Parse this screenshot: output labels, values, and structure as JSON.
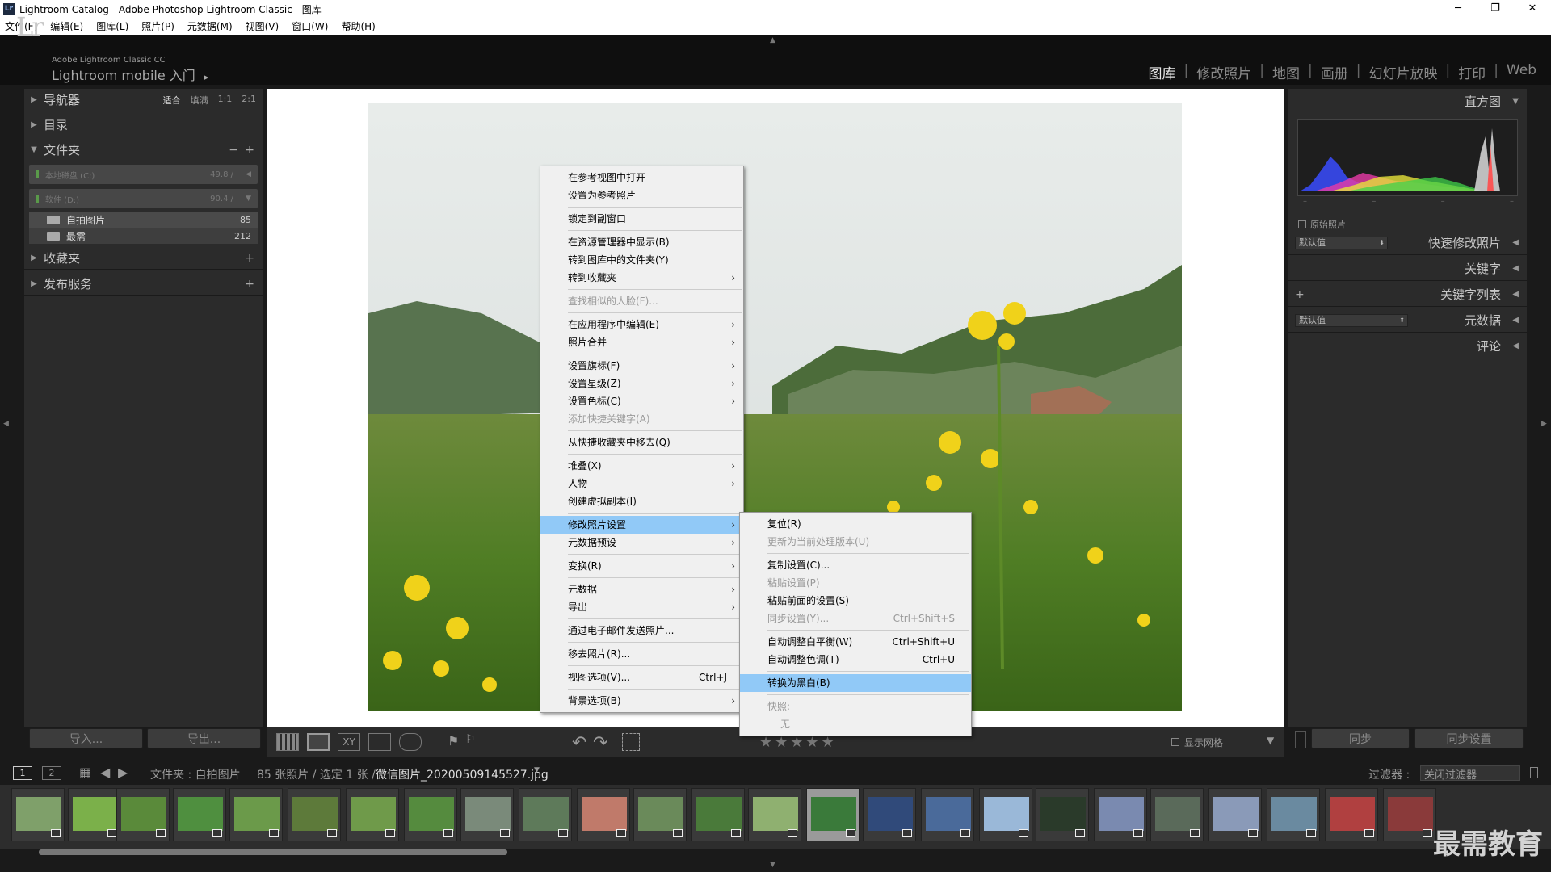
{
  "window": {
    "title": "Lightroom Catalog - Adobe Photoshop Lightroom Classic - 图库",
    "app_icon": "Lr",
    "minimize": "─",
    "maximize": "❐",
    "close": "✕"
  },
  "menubar": [
    "文件(F)",
    "编辑(E)",
    "图库(L)",
    "照片(P)",
    "元数据(M)",
    "视图(V)",
    "窗口(W)",
    "帮助(H)"
  ],
  "identity": {
    "logo": "Lr",
    "small": "Adobe Lightroom Classic CC",
    "mobile": "Lightroom mobile 入门",
    "mobile_arrow": "▸"
  },
  "modules": [
    "图库",
    "修改照片",
    "地图",
    "画册",
    "幻灯片放映",
    "打印",
    "Web"
  ],
  "left_panel": {
    "navigator": {
      "label": "导航器",
      "modes": [
        "适合",
        "填满",
        "1:1",
        "2:1"
      ]
    },
    "catalog": {
      "label": "目录"
    },
    "folders": {
      "label": "文件夹",
      "minus": "−",
      "plus": "+",
      "volumes": [
        {
          "name": "本地磁盘 (C:)",
          "size": "49.8 /",
          "arrow": "◀"
        },
        {
          "name": "软件 (D:)",
          "size": "90.4 /",
          "arrow": "▼"
        }
      ],
      "items": [
        {
          "name": "自拍图片",
          "count": "85"
        },
        {
          "name": "最需",
          "count": "212"
        }
      ]
    },
    "collections": {
      "label": "收藏夹",
      "plus": "+"
    },
    "publish": {
      "label": "发布服务",
      "plus": "+"
    },
    "import_label": "导入...",
    "export_label": "导出..."
  },
  "right_panel": {
    "histogram": {
      "label": "直方图",
      "original_photo": "原始照片",
      "dashes": "–"
    },
    "quick_develop": {
      "label": "快速修改照片",
      "preset": "默认值"
    },
    "keywording": {
      "label": "关键字"
    },
    "keyword_list": {
      "label": "关键字列表",
      "plus": "+"
    },
    "metadata": {
      "label": "元数据",
      "preset": "默认值"
    },
    "comments": {
      "label": "评论"
    },
    "sync_label": "同步",
    "sync_settings_label": "同步设置"
  },
  "toolbar": {
    "stars": "★★★★★",
    "show_grid": "显示网格",
    "xy": "XY",
    "rotate_left": "↶",
    "rotate_right": "↷"
  },
  "filmstrip_bar": {
    "page1": "1",
    "page2": "2",
    "source_prefix": "文件夹 : 自拍图片",
    "count_info": "85 张照片 / 选定 1 张 /",
    "filename": "微信图片_20200509145527.jpg",
    "filter_label": "过滤器 :",
    "filter_value": "关闭过滤器"
  },
  "context_menu": {
    "items": [
      {
        "label": "在参考视图中打开"
      },
      {
        "label": "设置为参考照片"
      },
      {
        "sep": true
      },
      {
        "label": "锁定到副窗口"
      },
      {
        "sep": true
      },
      {
        "label": "在资源管理器中显示(B)"
      },
      {
        "label": "转到图库中的文件夹(Y)"
      },
      {
        "label": "转到收藏夹",
        "sub": true
      },
      {
        "sep": true
      },
      {
        "label": "查找相似的人脸(F)...",
        "disabled": true
      },
      {
        "sep": true
      },
      {
        "label": "在应用程序中编辑(E)",
        "sub": true
      },
      {
        "label": "照片合并",
        "sub": true
      },
      {
        "sep": true
      },
      {
        "label": "设置旗标(F)",
        "sub": true
      },
      {
        "label": "设置星级(Z)",
        "sub": true
      },
      {
        "label": "设置色标(C)",
        "sub": true
      },
      {
        "label": "添加快捷关键字(A)",
        "disabled": true
      },
      {
        "sep": true
      },
      {
        "label": "从快捷收藏夹中移去(Q)"
      },
      {
        "sep": true
      },
      {
        "label": "堆叠(X)",
        "sub": true
      },
      {
        "label": "人物",
        "sub": true
      },
      {
        "label": "创建虚拟副本(I)"
      },
      {
        "sep": true
      },
      {
        "label": "修改照片设置",
        "sub": true,
        "highlight": true
      },
      {
        "label": "元数据预设",
        "sub": true
      },
      {
        "sep": true
      },
      {
        "label": "变换(R)",
        "sub": true
      },
      {
        "sep": true
      },
      {
        "label": "元数据",
        "sub": true
      },
      {
        "label": "导出",
        "sub": true
      },
      {
        "sep": true
      },
      {
        "label": "通过电子邮件发送照片..."
      },
      {
        "sep": true
      },
      {
        "label": "移去照片(R)..."
      },
      {
        "sep": true
      },
      {
        "label": "视图选项(V)...",
        "shortcut": "Ctrl+J"
      },
      {
        "sep": true
      },
      {
        "label": "背景选项(B)",
        "sub": true
      }
    ],
    "arrow": "›"
  },
  "submenu": {
    "items": [
      {
        "label": "复位(R)"
      },
      {
        "label": "更新为当前处理版本(U)",
        "disabled": true
      },
      {
        "sep": true
      },
      {
        "label": "复制设置(C)..."
      },
      {
        "label": "粘贴设置(P)",
        "disabled": true
      },
      {
        "label": "粘贴前面的设置(S)"
      },
      {
        "label": "同步设置(Y)...",
        "disabled": true,
        "shortcut": "Ctrl+Shift+S"
      },
      {
        "sep": true
      },
      {
        "label": "自动调整白平衡(W)",
        "shortcut": "Ctrl+Shift+U"
      },
      {
        "label": "自动调整色调(T)",
        "shortcut": "Ctrl+U"
      },
      {
        "sep": true
      },
      {
        "label": "转换为黑白(B)",
        "highlight": true
      },
      {
        "sep": true
      },
      {
        "label": "快照:",
        "disabled": true
      },
      {
        "label": "无",
        "disabled": true,
        "indent": true
      }
    ]
  },
  "watermark": "最需教育",
  "colors": {
    "highlight": "#91c9f7",
    "panel": "#2b2b2b",
    "background": "#1a1a1a"
  }
}
